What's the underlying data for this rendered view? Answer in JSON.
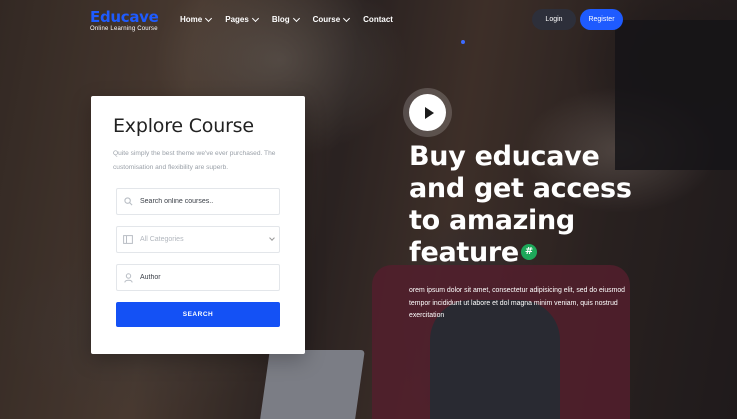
{
  "header": {
    "logo_title": "Educave",
    "logo_subtitle": "Online Learning Course",
    "nav": [
      {
        "label": "Home",
        "has_dropdown": true
      },
      {
        "label": "Pages",
        "has_dropdown": true
      },
      {
        "label": "Blog",
        "has_dropdown": true
      },
      {
        "label": "Course",
        "has_dropdown": true
      },
      {
        "label": "Contact",
        "has_dropdown": false
      }
    ],
    "login_label": "Login",
    "register_label": "Register"
  },
  "search_card": {
    "title": "Explore Course",
    "description": "Quite simply the best theme we've ever purchased. The customisation and flexibility are superb.",
    "course_placeholder": "Search online courses..",
    "category_value": "All Categories",
    "author_placeholder": "Author",
    "search_label": "SEARCH",
    "icons": [
      "search-icon",
      "category-icon",
      "user-icon"
    ]
  },
  "hero": {
    "title_lines": [
      "Buy educave",
      "and get access",
      "to amazing",
      "feature"
    ],
    "badge_glyph": "#",
    "description": "orem ipsum dolor sit amet, consectetur adipisicing elit, sed do eiusmod tempor incididunt ut labore et dol magna minim veniam, quis nostrud exercitation"
  },
  "colors": {
    "brand": "#1e5bff",
    "search_button": "#1451f5",
    "login_button": "#2d2f3a",
    "badge": "#1ea85a"
  }
}
